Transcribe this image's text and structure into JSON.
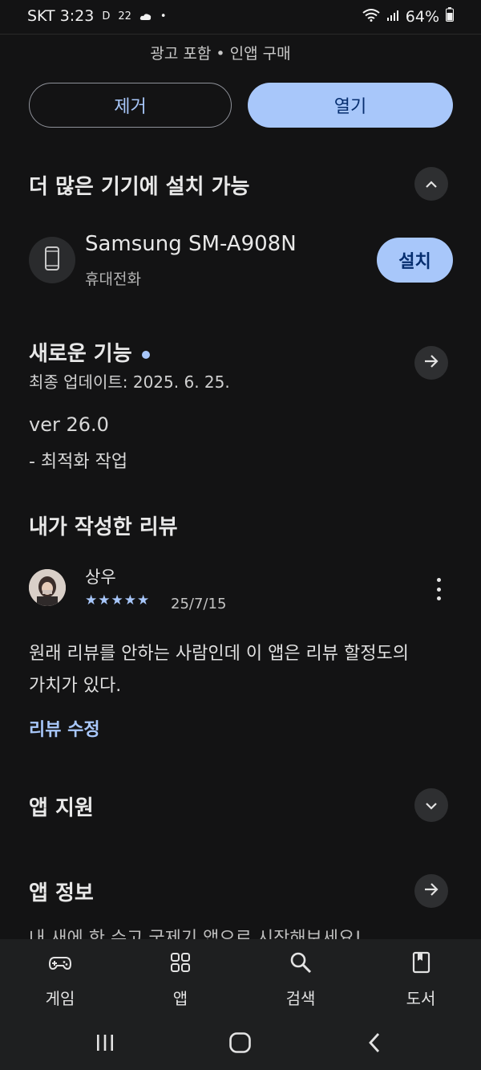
{
  "status_bar": {
    "carrier_time": "SKT 3:23",
    "indicator_d": "D",
    "indicator_22": "22",
    "dot": "•",
    "battery": "64%"
  },
  "app_meta": {
    "subtitle": "광고 포함 • 인앱 구매"
  },
  "actions": {
    "uninstall": "제거",
    "open": "열기"
  },
  "devices": {
    "title": "더 많은 기기에 설치 가능",
    "device_name": "Samsung SM-A908N",
    "device_type": "휴대전화",
    "install": "설치"
  },
  "whats_new": {
    "title": "새로운 기능",
    "updated": "최종 업데이트: 2025. 6. 25.",
    "version": "ver 26.0",
    "note": "- 최적화 작업"
  },
  "my_review": {
    "title": "내가 작성한 리뷰",
    "reviewer": "상우",
    "stars": "★★★★★",
    "rating": 5,
    "date": "25/7/15",
    "body": "원래 리뷰를 안하는 사람인데 이 앱은 리뷰 할정도의 가치가 있다.",
    "edit": "리뷰 수정"
  },
  "app_support": {
    "title": "앱 지원"
  },
  "app_info": {
    "title": "앱 정보",
    "cut_text": "내 새에 한 수고 국제기 앱으로 시작해보세요!"
  },
  "bottom_nav": [
    {
      "label": "게임",
      "icon": "gamepad-icon"
    },
    {
      "label": "앱",
      "icon": "apps-grid-icon"
    },
    {
      "label": "검색",
      "icon": "search-icon"
    },
    {
      "label": "도서",
      "icon": "book-icon"
    }
  ],
  "colors": {
    "accent": "#a8c7fa",
    "background": "#131314",
    "nav_bg": "#1e1f20"
  }
}
